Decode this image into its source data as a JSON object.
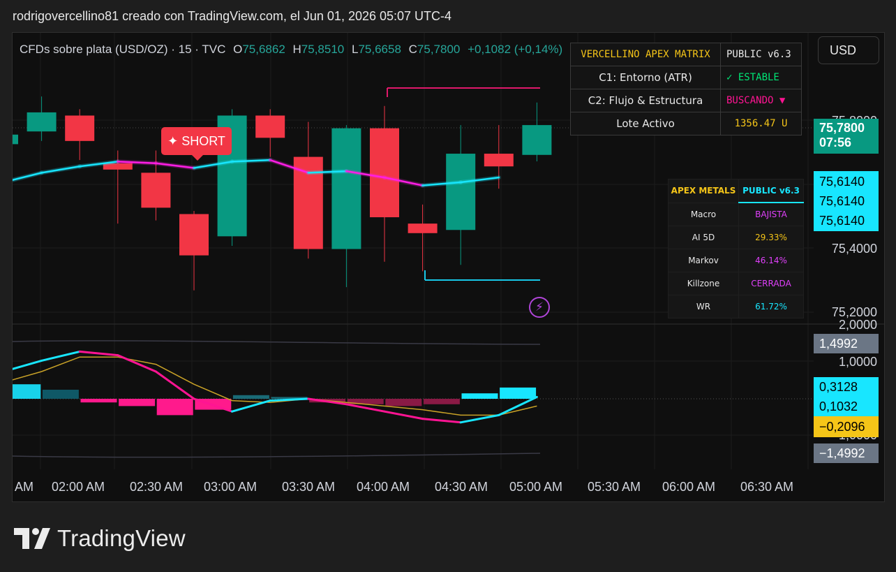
{
  "header": {
    "text": "rodrigovercellino81 creado con TradingView.com, el Jun 01, 2026 05:07 UTC-4"
  },
  "legend": {
    "symbol": "CFDs sobre plata (USD/OZ) · 15 · TVC",
    "o_label": "O",
    "o_value": "75,6862",
    "h_label": "H",
    "h_value": "75,8510",
    "l_label": "L",
    "l_value": "75,6658",
    "c_label": "C",
    "c_value": "75,7800",
    "change": "+0,1082 (+0,14%)"
  },
  "currency_button": "USD",
  "price_axis": {
    "labels": [
      "75,8000",
      "75,4000",
      "75,2000"
    ],
    "current_price": "75,7800",
    "countdown": "07:56",
    "cyan_tags": [
      "75,6140",
      "75,6140",
      "75,6140"
    ]
  },
  "osc_axis": {
    "labels": [
      "2,0000",
      "1,0000",
      "-1,0000"
    ],
    "band_upper": "1,4992",
    "band_lower": "−1,4992",
    "cyan_tags": [
      "0,3128",
      "0,1032"
    ],
    "yellow_tag": "−0,2096"
  },
  "time_axis": [
    "AM",
    "02:00 AM",
    "02:30 AM",
    "03:00 AM",
    "03:30 AM",
    "04:00 AM",
    "04:30 AM",
    "05:00 AM",
    "05:30 AM",
    "06:00 AM",
    "06:30 AM"
  ],
  "matrix": {
    "title": "VERCELLINO APEX MATRIX",
    "version": "PUBLIC v6.3",
    "rows": [
      {
        "label": "C1: Entorno (ATR)",
        "value": "✓ ESTABLE",
        "color": "#00e676"
      },
      {
        "label": "C2: Flujo & Estructura",
        "value": "BUSCANDO ▼",
        "color": "#ff1493"
      },
      {
        "label": "Lote Activo",
        "value": "1356.47 U",
        "color": "#f5c518"
      }
    ]
  },
  "apex": {
    "title": "APEX METALS",
    "version": "PUBLIC v6.3",
    "rows": [
      {
        "label": "Macro",
        "value": "BAJISTA",
        "color": "#e040fb"
      },
      {
        "label": "AI 5D",
        "value": "29.33%",
        "color": "#f5c518"
      },
      {
        "label": "Markov",
        "value": "46.14%",
        "color": "#e040fb"
      },
      {
        "label": "Killzone",
        "value": "CERRADA",
        "color": "#e040fb"
      },
      {
        "label": "WR",
        "value": "61.72%",
        "color": "#18e6ff"
      }
    ]
  },
  "signal": {
    "label": "✦ SHORT"
  },
  "icons": {
    "lightning": "lightning-icon",
    "logo": "tradingview-logo"
  },
  "footer": {
    "brand": "TradingView"
  },
  "colors": {
    "up": "#089981",
    "down": "#f23645",
    "cyan": "#18e6ff",
    "magenta": "#ff1493",
    "yellow": "#f5c518"
  },
  "chart_data": {
    "type": "candlestick",
    "title": "CFDs sobre plata (USD/OZ) · 15 · TVC",
    "ylim": [
      75.17,
      75.93
    ],
    "candles": [
      {
        "o": 75.72,
        "h": 75.74,
        "c": 75.75,
        "l": 75.69
      },
      {
        "o": 75.76,
        "h": 75.87,
        "c": 75.82,
        "l": 75.73
      },
      {
        "o": 75.81,
        "h": 75.83,
        "c": 75.73,
        "l": 75.67
      },
      {
        "o": 75.66,
        "h": 75.7,
        "c": 75.64,
        "l": 75.47
      },
      {
        "o": 75.63,
        "h": 75.7,
        "c": 75.52,
        "l": 75.48
      },
      {
        "o": 75.5,
        "h": 75.51,
        "c": 75.37,
        "l": 75.26
      },
      {
        "o": 75.43,
        "h": 75.83,
        "c": 75.81,
        "l": 75.4
      },
      {
        "o": 75.81,
        "h": 75.83,
        "c": 75.74,
        "l": 75.68
      },
      {
        "o": 75.68,
        "h": 75.79,
        "c": 75.39,
        "l": 75.36
      },
      {
        "o": 75.39,
        "h": 75.78,
        "c": 75.77,
        "l": 75.27
      },
      {
        "o": 75.77,
        "h": 75.84,
        "c": 75.49,
        "l": 75.35
      },
      {
        "o": 75.47,
        "h": 75.53,
        "c": 75.44,
        "l": 75.32
      },
      {
        "o": 75.45,
        "h": 75.78,
        "c": 75.69,
        "l": 75.34
      },
      {
        "o": 75.69,
        "h": 75.78,
        "c": 75.65,
        "l": 75.58
      },
      {
        "o": 75.6862,
        "h": 75.851,
        "c": 75.78,
        "l": 75.6658
      }
    ],
    "ma": [
      75.6,
      75.63,
      75.65,
      75.665,
      75.66,
      75.645,
      75.665,
      75.67,
      75.63,
      75.635,
      75.615,
      75.59,
      75.6,
      75.615
    ],
    "oscillator": {
      "fast": [
        0.75,
        1.05,
        1.3,
        1.2,
        0.75,
        0.0,
        -0.35,
        -0.05,
        0.0,
        -0.15,
        -0.35,
        -0.55,
        -0.65,
        -0.45,
        0.05
      ],
      "slow": [
        0.45,
        0.75,
        1.15,
        1.15,
        0.95,
        0.4,
        -0.05,
        -0.1,
        0.0,
        -0.1,
        -0.2,
        -0.3,
        -0.45,
        -0.45,
        -0.2
      ],
      "hist": [
        0.4,
        0.25,
        -0.1,
        -0.2,
        -0.45,
        -0.3,
        0.1,
        0.05,
        -0.1,
        -0.15,
        -0.2,
        -0.15,
        0.15,
        0.31
      ],
      "band_upper": 1.4992,
      "band_lower": -1.4992
    }
  }
}
